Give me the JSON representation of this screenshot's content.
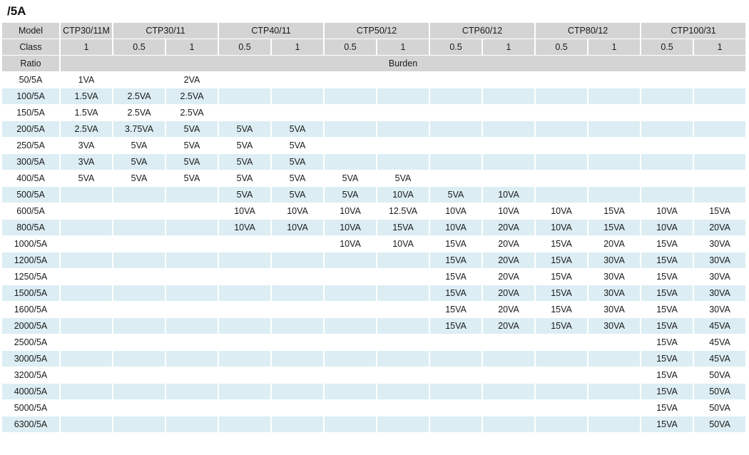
{
  "title": "/5A",
  "table": {
    "row_headers": {
      "model_label": "Model",
      "class_label": "Class",
      "ratio_label": "Ratio",
      "burden_label": "Burden"
    },
    "models": [
      {
        "name": "CTP30/11M",
        "classes": [
          "1"
        ]
      },
      {
        "name": "CTP30/11",
        "classes": [
          "0.5",
          "1"
        ]
      },
      {
        "name": "CTP40/11",
        "classes": [
          "0.5",
          "1"
        ]
      },
      {
        "name": "CTP50/12",
        "classes": [
          "0.5",
          "1"
        ]
      },
      {
        "name": "CTP60/12",
        "classes": [
          "0.5",
          "1"
        ]
      },
      {
        "name": "CTP80/12",
        "classes": [
          "0.5",
          "1"
        ]
      },
      {
        "name": "CTP100/31",
        "classes": [
          "0.5",
          "1"
        ]
      }
    ],
    "columns": [
      "CTP30/11M 1",
      "CTP30/11 0.5",
      "CTP30/11 1",
      "CTP40/11 0.5",
      "CTP40/11 1",
      "CTP50/12 0.5",
      "CTP50/12 1",
      "CTP60/12 0.5",
      "CTP60/12 1",
      "CTP80/12 0.5",
      "CTP80/12 1",
      "CTP100/31 0.5",
      "CTP100/31 1"
    ],
    "rows": [
      {
        "ratio": "50/5A",
        "values": [
          "1VA",
          "",
          "2VA",
          "",
          "",
          "",
          "",
          "",
          "",
          "",
          "",
          "",
          ""
        ]
      },
      {
        "ratio": "100/5A",
        "values": [
          "1.5VA",
          "2.5VA",
          "2.5VA",
          "",
          "",
          "",
          "",
          "",
          "",
          "",
          "",
          "",
          ""
        ]
      },
      {
        "ratio": "150/5A",
        "values": [
          "1.5VA",
          "2.5VA",
          "2.5VA",
          "",
          "",
          "",
          "",
          "",
          "",
          "",
          "",
          "",
          ""
        ]
      },
      {
        "ratio": "200/5A",
        "values": [
          "2.5VA",
          "3.75VA",
          "5VA",
          "5VA",
          "5VA",
          "",
          "",
          "",
          "",
          "",
          "",
          "",
          ""
        ]
      },
      {
        "ratio": "250/5A",
        "values": [
          "3VA",
          "5VA",
          "5VA",
          "5VA",
          "5VA",
          "",
          "",
          "",
          "",
          "",
          "",
          "",
          ""
        ]
      },
      {
        "ratio": "300/5A",
        "values": [
          "3VA",
          "5VA",
          "5VA",
          "5VA",
          "5VA",
          "",
          "",
          "",
          "",
          "",
          "",
          "",
          ""
        ]
      },
      {
        "ratio": "400/5A",
        "values": [
          "5VA",
          "5VA",
          "5VA",
          "5VA",
          "5VA",
          "5VA",
          "5VA",
          "",
          "",
          "",
          "",
          "",
          ""
        ]
      },
      {
        "ratio": "500/5A",
        "values": [
          "",
          "",
          "",
          "5VA",
          "5VA",
          "5VA",
          "10VA",
          "5VA",
          "10VA",
          "",
          "",
          "",
          ""
        ]
      },
      {
        "ratio": "600/5A",
        "values": [
          "",
          "",
          "",
          "10VA",
          "10VA",
          "10VA",
          "12.5VA",
          "10VA",
          "10VA",
          "10VA",
          "15VA",
          "10VA",
          "15VA"
        ]
      },
      {
        "ratio": "800/5A",
        "values": [
          "",
          "",
          "",
          "10VA",
          "10VA",
          "10VA",
          "15VA",
          "10VA",
          "20VA",
          "10VA",
          "15VA",
          "10VA",
          "20VA"
        ]
      },
      {
        "ratio": "1000/5A",
        "values": [
          "",
          "",
          "",
          "",
          "",
          "10VA",
          "10VA",
          "15VA",
          "20VA",
          "15VA",
          "20VA",
          "15VA",
          "30VA"
        ]
      },
      {
        "ratio": "1200/5A",
        "values": [
          "",
          "",
          "",
          "",
          "",
          "",
          "",
          "15VA",
          "20VA",
          "15VA",
          "30VA",
          "15VA",
          "30VA"
        ]
      },
      {
        "ratio": "1250/5A",
        "values": [
          "",
          "",
          "",
          "",
          "",
          "",
          "",
          "15VA",
          "20VA",
          "15VA",
          "30VA",
          "15VA",
          "30VA"
        ]
      },
      {
        "ratio": "1500/5A",
        "values": [
          "",
          "",
          "",
          "",
          "",
          "",
          "",
          "15VA",
          "20VA",
          "15VA",
          "30VA",
          "15VA",
          "30VA"
        ]
      },
      {
        "ratio": "1600/5A",
        "values": [
          "",
          "",
          "",
          "",
          "",
          "",
          "",
          "15VA",
          "20VA",
          "15VA",
          "30VA",
          "15VA",
          "30VA"
        ]
      },
      {
        "ratio": "2000/5A",
        "values": [
          "",
          "",
          "",
          "",
          "",
          "",
          "",
          "15VA",
          "20VA",
          "15VA",
          "30VA",
          "15VA",
          "45VA"
        ]
      },
      {
        "ratio": "2500/5A",
        "values": [
          "",
          "",
          "",
          "",
          "",
          "",
          "",
          "",
          "",
          "",
          "",
          "15VA",
          "45VA"
        ]
      },
      {
        "ratio": "3000/5A",
        "values": [
          "",
          "",
          "",
          "",
          "",
          "",
          "",
          "",
          "",
          "",
          "",
          "15VA",
          "45VA"
        ]
      },
      {
        "ratio": "3200/5A",
        "values": [
          "",
          "",
          "",
          "",
          "",
          "",
          "",
          "",
          "",
          "",
          "",
          "15VA",
          "50VA"
        ]
      },
      {
        "ratio": "4000/5A",
        "values": [
          "",
          "",
          "",
          "",
          "",
          "",
          "",
          "",
          "",
          "",
          "",
          "15VA",
          "50VA"
        ]
      },
      {
        "ratio": "5000/5A",
        "values": [
          "",
          "",
          "",
          "",
          "",
          "",
          "",
          "",
          "",
          "",
          "",
          "15VA",
          "50VA"
        ]
      },
      {
        "ratio": "6300/5A",
        "values": [
          "",
          "",
          "",
          "",
          "",
          "",
          "",
          "",
          "",
          "",
          "",
          "15VA",
          "50VA"
        ]
      }
    ]
  },
  "colors": {
    "header_bg": "#d4d4d4",
    "stripe_bg": "#dceef4",
    "page_bg": "#ffffff",
    "text": "#1a1a1a"
  }
}
